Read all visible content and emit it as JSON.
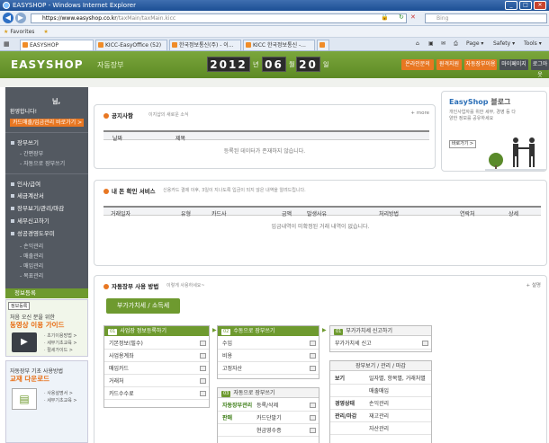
{
  "browser": {
    "title": "EASYSHOP - Windows Internet Explorer",
    "url_domain": "https://www.easyshop.co.kr",
    "url_rest": "/taxMain/taxMain.kicc",
    "search_placeholder": "Bing",
    "favorites_label": "Favorites",
    "tabs": [
      "EASYSHOP",
      "KICC-EasyOffice (52)",
      "한국정보통신(주) - 이...",
      "KICC 한국정보통신 -..."
    ],
    "tools": {
      "page": "Page ▾",
      "safety": "Safety ▾",
      "tools": "Tools ▾"
    }
  },
  "header": {
    "logo": "EASYSHOP",
    "logo_sub": "자동장부",
    "date": {
      "year": "2012",
      "year_unit": "년",
      "month": "06",
      "month_unit": "월",
      "day": "20",
      "day_unit": "일"
    },
    "buttons": [
      "온라인문의",
      "원격지원",
      "자동장부이용",
      "마이페이지",
      "로그아웃"
    ]
  },
  "sidebar": {
    "user": "님,",
    "welcome": "환영합니다!",
    "card_button": "카드매출/입금관리 바로가기 >",
    "menu": [
      {
        "label": "장부쓰기",
        "sub": [
          "간편장부",
          "자동으로 장부쓰기"
        ]
      },
      {
        "label": "인사/급여",
        "sub": []
      },
      {
        "label": "세금계산서",
        "sub": []
      },
      {
        "label": "장부보기/관리/마감",
        "sub": []
      },
      {
        "label": "세무신고하기",
        "sub": []
      },
      {
        "label": "성공경영도우미",
        "sub": [
          "손익관리",
          "매출관리",
          "매입관리",
          "목표관리"
        ]
      }
    ],
    "banner_header": "정보등록",
    "banner1": {
      "tag": "정보등록",
      "line1": "처음 오신 분을 위한",
      "headline": "동영상 이용 가이드",
      "links": [
        "초기이용방법 >",
        "세무기초교육 >",
        "절세가이드 >"
      ]
    },
    "banner2": {
      "line1": "자동장부 기초 사용방법",
      "headline": "교재 다운로드",
      "links": [
        "사용설명서 >",
        "세무기초교육 >"
      ]
    }
  },
  "notice": {
    "title": "공지사항",
    "subtitle": "이지샵의 새로운 소식",
    "more": "+ more",
    "columns": [
      "날짜",
      "제목"
    ],
    "empty": "등록된 데이터가 존재하지 않습니다."
  },
  "blog": {
    "title": "EasyShop",
    "title_suffix": "블로그",
    "desc": "개인사업자를 위한 세무, 경영 등 다양한 정보를 공유하세요",
    "button": "바로가기 >"
  },
  "confirm": {
    "title": "내 돈 확인 서비스",
    "subtitle": "신용카드 결제 이후, 3일이 지나도록 입금이 되지 않은 내역을 알려드립니다.",
    "columns": [
      "거래일자",
      "유형",
      "카드사",
      "금액",
      "발생사유",
      "처리방법",
      "연락처",
      "상세"
    ],
    "empty": "입금내역이 미확정된 거래 내역이 없습니다."
  },
  "usage": {
    "title": "자동장부 사용 방법",
    "subtitle": "이렇게 사용하세요~",
    "more": "+ 설명",
    "category_button": "부가가치세 / 소득세",
    "box1": {
      "num": "01",
      "title": "사업장 정보등록하기",
      "items": [
        "기본정보(필수)",
        "사업용계좌",
        "매입카드",
        "거래처",
        "카드수수료"
      ]
    },
    "box2": {
      "num": "02",
      "title": "수동으로 장부쓰기",
      "items": [
        "수입",
        "비용",
        "고정자산"
      ]
    },
    "box3": {
      "num": "03",
      "title": "자동으로 장부쓰기",
      "items": [
        {
          "k": "자동장부관리",
          "v": "등록/삭제"
        },
        {
          "k": "판매",
          "v": "카드단말기"
        },
        {
          "k": "",
          "v": "현금영수증"
        }
      ]
    },
    "box4": {
      "num": "01",
      "title": "부가가치세 신고하기",
      "items": [
        "부가가치세 신고"
      ]
    },
    "box5": {
      "title": "장부보기 / 관리 / 마감",
      "items": [
        {
          "k": "보기",
          "v": "일자별, 항목별, 거래처별"
        },
        {
          "k": "",
          "v": "매출매입"
        },
        {
          "k": "경영상태",
          "v": "손익관리"
        },
        {
          "k": "관리/마감",
          "v": "재고관리"
        },
        {
          "k": "",
          "v": "자산관리"
        }
      ]
    }
  }
}
